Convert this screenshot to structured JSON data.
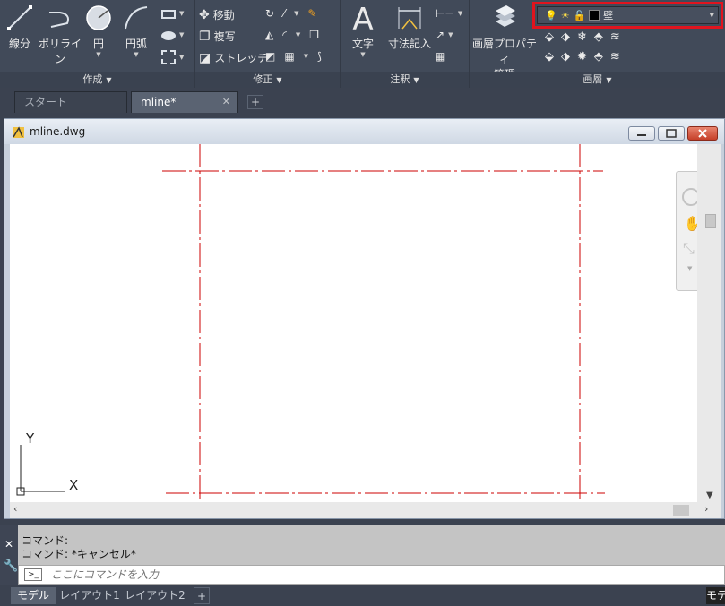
{
  "ribbon": {
    "draw_panel": {
      "title": "作成",
      "line": "線分",
      "polyline": "ポリライン",
      "circle": "円",
      "arc": "円弧"
    },
    "modify_panel": {
      "title": "修正",
      "move": "移動",
      "copy": "複写",
      "stretch": "ストレッチ"
    },
    "annotation_panel": {
      "title": "注釈",
      "text": "文字",
      "dimension": "寸法記入"
    },
    "layers_panel": {
      "title": "画層",
      "layer_properties_line1": "画層プロパティ",
      "layer_properties_line2": "管理",
      "current_layer": "壁",
      "current_layer_color": "#000000"
    }
  },
  "tabs": {
    "start": "スタート",
    "active": "mline*"
  },
  "drawing": {
    "filename": "mline.dwg",
    "axis_x": "X",
    "axis_y": "Y",
    "line_color": "#cc0000"
  },
  "command": {
    "history_1": "コマンド:",
    "history_2": "コマンド:  *キャンセル*",
    "placeholder": "ここにコマンドを入力"
  },
  "layout_tabs": {
    "model": "モデル",
    "layout1": "レイアウト1",
    "layout2": "レイアウト2",
    "status": "モデ"
  }
}
